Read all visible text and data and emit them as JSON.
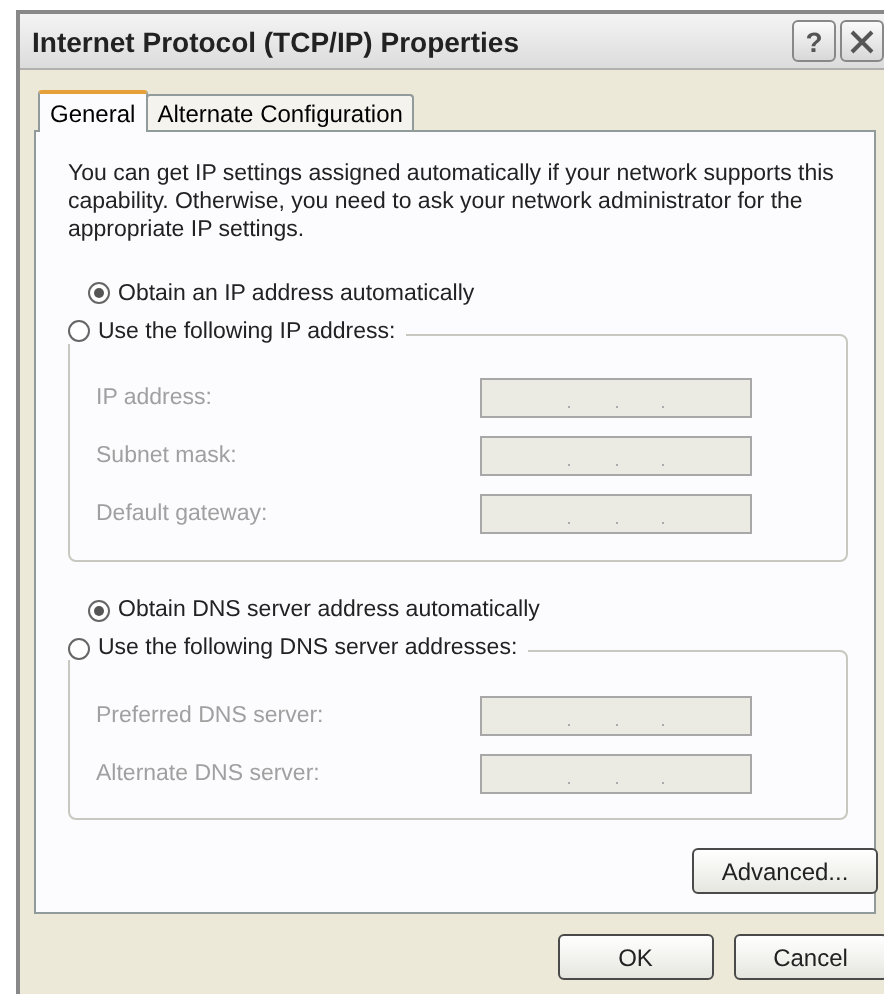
{
  "window": {
    "title": "Internet Protocol (TCP/IP) Properties",
    "help_button": "?"
  },
  "tabs": [
    {
      "label": "General",
      "selected": true
    },
    {
      "label": "Alternate Configuration",
      "selected": false
    }
  ],
  "description": "You can get IP settings assigned automatically if your network supports this capability. Otherwise, you need to ask your network administrator for the appropriate IP settings.",
  "ip_section": {
    "options": [
      {
        "label": "Obtain an IP address automatically",
        "selected": true
      },
      {
        "label": "Use the following IP address:",
        "selected": false
      }
    ],
    "fields": [
      {
        "label": "IP address:",
        "disabled": true
      },
      {
        "label": "Subnet mask:",
        "disabled": true
      },
      {
        "label": "Default gateway:",
        "disabled": true
      }
    ]
  },
  "dns_section": {
    "options": [
      {
        "label": "Obtain DNS server address automatically",
        "selected": true
      },
      {
        "label": "Use the following DNS server addresses:",
        "selected": false
      }
    ],
    "fields": [
      {
        "label": "Preferred DNS server:",
        "disabled": true
      },
      {
        "label": "Alternate DNS server:",
        "disabled": true
      }
    ]
  },
  "advanced_button": "Advanced...",
  "buttons": [
    "OK",
    "Cancel"
  ]
}
